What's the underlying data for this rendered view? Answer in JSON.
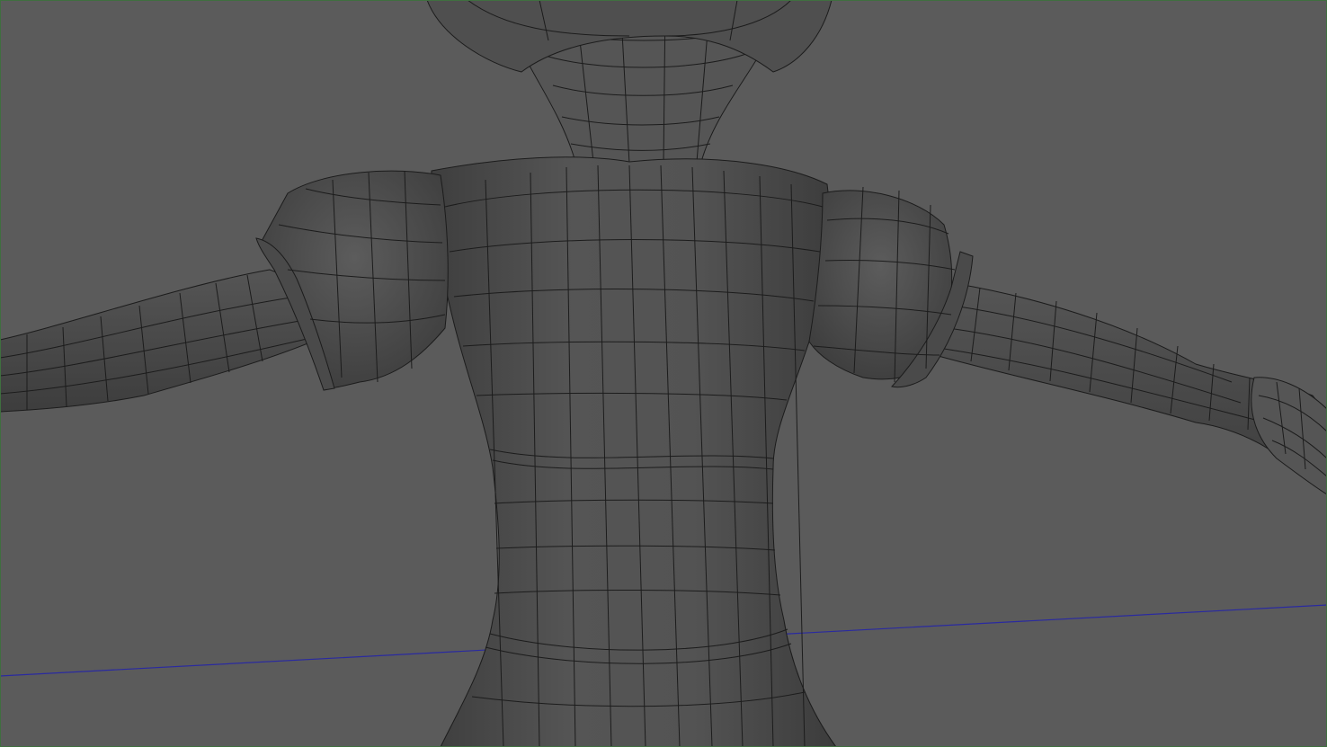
{
  "viewport": {
    "panel": "3d-perspective-viewport",
    "mode": "wireframe-on-shaded",
    "colors": {
      "background": "#5b5b5b",
      "frame_border": "#3f6f3f",
      "mesh_fill": "#4e4e4e",
      "mesh_fill_light": "#5a5a5a",
      "wire": "#1c1c1c",
      "grid_axis": "#2a2aa0"
    },
    "icons": [
      "grid-axis-line",
      "character-mesh"
    ]
  }
}
